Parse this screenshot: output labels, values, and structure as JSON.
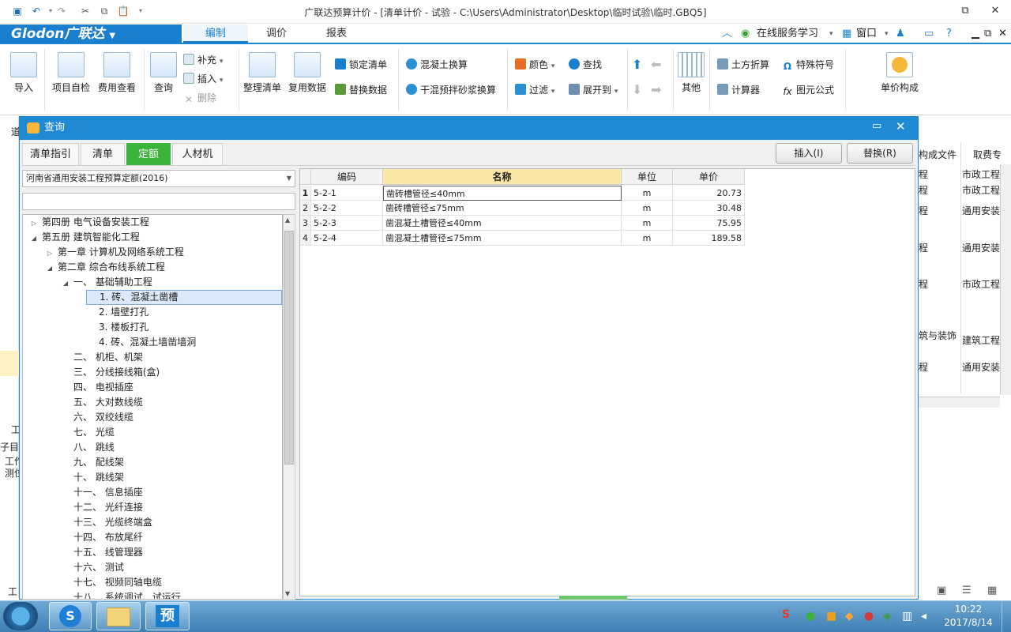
{
  "window": {
    "title": "广联达预算计价 - [清单计价 - 试验 - C:\\Users\\Administrator\\Desktop\\临时试验\\临时.GBQ5]"
  },
  "brand": {
    "logo": "Glodon广联达"
  },
  "ribbon_tabs": [
    "编制",
    "调价",
    "报表"
  ],
  "topright": {
    "online": "在线服务学习",
    "window": "窗口"
  },
  "ribbon": {
    "import": "导入",
    "self_check": "项目自检",
    "fee_view": "费用查看",
    "query": "查询",
    "supplement": "补充",
    "insert": "插入",
    "delete": "删除",
    "organize": "整理清单",
    "reuse": "复用数据",
    "lock": "锁定清单",
    "replace_data": "替换数据",
    "concrete": "混凝土换算",
    "mortar": "干混预拌砂浆换算",
    "color": "颜色",
    "find": "查找",
    "filter": "过滤",
    "expand": "展开到",
    "other": "其他",
    "earth": "土方折算",
    "special": "特殊符号",
    "calc": "计算器",
    "formula": "图元公式",
    "unit_price": "单价构成"
  },
  "dialog": {
    "title": "查询",
    "tabs": [
      "清单指引",
      "清单",
      "定额",
      "人材机"
    ],
    "insert_btn": "插入(I)",
    "replace_btn": "替换(R)",
    "library": "河南省通用安装工程预算定额(2016)"
  },
  "tree": [
    {
      "label": "第四册 电气设备安装工程",
      "level": 0,
      "toggle": "▷"
    },
    {
      "label": "第五册 建筑智能化工程",
      "level": 0,
      "toggle": "◢"
    },
    {
      "label": "第一章 计算机及网络系统工程",
      "level": 1,
      "toggle": "▷"
    },
    {
      "label": "第二章 综合布线系统工程",
      "level": 1,
      "toggle": "◢"
    },
    {
      "label": "一、 基础辅助工程",
      "level": 2,
      "toggle": "◢"
    },
    {
      "label": "1. 砖、混凝土凿槽",
      "level": 3,
      "toggle": "",
      "selected": true
    },
    {
      "label": "2. 墙壁打孔",
      "level": 3,
      "toggle": ""
    },
    {
      "label": "3. 楼板打孔",
      "level": 3,
      "toggle": ""
    },
    {
      "label": "4. 砖、混凝土墙凿墙洞",
      "level": 3,
      "toggle": ""
    },
    {
      "label": "二、 机柜、机架",
      "level": 2,
      "toggle": ""
    },
    {
      "label": "三、 分线接线箱(盒)",
      "level": 2,
      "toggle": ""
    },
    {
      "label": "四、 电视插座",
      "level": 2,
      "toggle": ""
    },
    {
      "label": "五、 大对数线缆",
      "level": 2,
      "toggle": ""
    },
    {
      "label": "六、 双绞线缆",
      "level": 2,
      "toggle": ""
    },
    {
      "label": "七、 光缆",
      "level": 2,
      "toggle": ""
    },
    {
      "label": "八、 跳线",
      "level": 2,
      "toggle": ""
    },
    {
      "label": "九、 配线架",
      "level": 2,
      "toggle": ""
    },
    {
      "label": "十、 跳线架",
      "level": 2,
      "toggle": ""
    },
    {
      "label": "十一、 信息插座",
      "level": 2,
      "toggle": ""
    },
    {
      "label": "十二、 光纤连接",
      "level": 2,
      "toggle": ""
    },
    {
      "label": "十三、 光缆终端盒",
      "level": 2,
      "toggle": ""
    },
    {
      "label": "十四、 布放尾纤",
      "level": 2,
      "toggle": ""
    },
    {
      "label": "十五、 线管理器",
      "level": 2,
      "toggle": ""
    },
    {
      "label": "十六、 测试",
      "level": 2,
      "toggle": ""
    },
    {
      "label": "十七、 视频同轴电缆",
      "level": 2,
      "toggle": ""
    },
    {
      "label": "十八、 系统调试、试运行",
      "level": 2,
      "toggle": ""
    }
  ],
  "grid": {
    "headers": [
      "编码",
      "名称",
      "单位",
      "单价"
    ],
    "rows": [
      {
        "n": "1",
        "code": "5-2-1",
        "name": "凿砖槽管径≤40mm",
        "unit": "m",
        "price": "20.73"
      },
      {
        "n": "2",
        "code": "5-2-2",
        "name": "凿砖槽管径≤75mm",
        "unit": "m",
        "price": "30.48"
      },
      {
        "n": "3",
        "code": "5-2-3",
        "name": "凿混凝土槽管径≤40mm",
        "unit": "m",
        "price": "75.95"
      },
      {
        "n": "4",
        "code": "5-2-4",
        "name": "凿混凝土槽管径≤75mm",
        "unit": "m",
        "price": "189.58"
      }
    ]
  },
  "background": {
    "header_a": "构成文件",
    "header_b": "取费专",
    "col_a": [
      "程",
      "程",
      "程",
      "程",
      "程",
      "筑与装饰",
      "程"
    ],
    "col_b": [
      "市政工程",
      "市政工程",
      "通用安装",
      "通用安装",
      "市政工程",
      "建筑工程",
      "通用安装"
    ],
    "left_text": [
      "道",
      "工",
      "子目",
      "工作",
      "测位",
      "工"
    ]
  },
  "taskbar": {
    "time": "10:22",
    "date": "2017/8/14",
    "app3": "预"
  }
}
